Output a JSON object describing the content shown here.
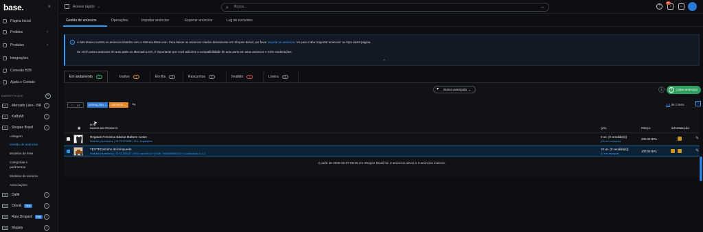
{
  "app": {
    "logo": "base."
  },
  "sidebar": {
    "collapse": "«",
    "items": [
      {
        "label": "Página Inicial"
      },
      {
        "label": "Pedidos"
      },
      {
        "label": "Produtos"
      },
      {
        "label": "Integrações"
      },
      {
        "label": "Conexão B2B"
      },
      {
        "label": "Ajuda e Contato"
      }
    ],
    "section_label": "MARKETPLACE",
    "marketplaces": [
      {
        "label": "Mercado Livre - BR",
        "icon": "ML"
      },
      {
        "label": "KaBuM!",
        "icon": "Kb"
      },
      {
        "label": "Shopee Brasil",
        "icon": "Sh"
      }
    ],
    "shopee_sub": [
      "Listagem",
      "Gestão de anúncios",
      "Modelos de frete",
      "Categorias e",
      "parâmetros",
      "Modelos de anúncio",
      "Associações"
    ],
    "more_marketplaces": [
      {
        "label": "Dafiti",
        "icon": "Da",
        "badge": ""
      },
      {
        "label": "Omnik",
        "icon": "Om",
        "badge": "Beta"
      },
      {
        "label": "Raia Drogasil",
        "icon": "RD",
        "badge": "Beta"
      },
      {
        "label": "Magalu",
        "icon": "Mg",
        "badge": ""
      }
    ]
  },
  "topbar": {
    "quick_access": "Acesso rápido",
    "search_placeholder": "Busca...",
    "notif_count": "99",
    "help": "?"
  },
  "tabs": [
    "Gestão de anúncios",
    "Operações",
    "Importar anúncios",
    "Exportar anúncios",
    "Log de excluídos"
  ],
  "info": {
    "line1_a": "A lista abaixo mostra os anúncios listados com o sistema Base.com. Para baixar os anúncios criados diretamente em Shopee Brasil, por favor ",
    "line1_link": "importe os anúncios",
    "line1_b": ". Vá para a aba 'Importar anúncios' no topo desta página.",
    "line2": "Se você possui anúncios de auto parts no Mercado Livre, é importante que você adicione a compatibilidade de auto parts em seus anúncios e evite moderações."
  },
  "status_tabs": [
    {
      "label": "Em andamento",
      "count": "2",
      "color": "green"
    },
    {
      "label": "Inativo",
      "count": "3",
      "color": "orange"
    },
    {
      "label": "Em fila",
      "count": "0",
      "color": ""
    },
    {
      "label": "Rascunhos",
      "count": "0",
      "color": ""
    },
    {
      "label": "Inválido",
      "count": "1",
      "color": "red"
    },
    {
      "label": "Lixeira",
      "count": "0",
      "color": ""
    }
  ],
  "panel": {
    "advanced_search": "Busca avançada",
    "list_button": "Listar anúncios",
    "selection": "1/2",
    "operations": "OPERAÇÕES",
    "support": "SUPORTE",
    "pagination_range": "1-2",
    "pagination_rest": " de 2 itens",
    "page": "1"
  },
  "table": {
    "headers": {
      "id": "ID ⇅",
      "product": "DADOS DO PRODUTO",
      "qty": "QTD.",
      "price": "PREÇO",
      "info": "INFORMAÇÃO"
    },
    "rows": [
      {
        "name": "Regatas Feminina Básica Malwee Coton",
        "meta": "Padrão (Inventário) | ID 72174035 | SKU regatafem",
        "qty": "0 un. (0 vendido(s))",
        "stock": "(25 em estoque)",
        "price": "200.00 BRL",
        "selected": false
      },
      {
        "name": "TESTECarrinho de brinquedo",
        "meta": "Padrão (Inventário) | ID 62435022 | SKU carrinho12 | EAN 7908508000310 | Localização A-1-1",
        "qty": "10 un. (0 vendido(s))",
        "stock": "(0 em estoque)",
        "price": "100.00 BRL",
        "selected": true
      }
    ]
  },
  "footer": "A partir de 2025-05-07 09:26 em Shopee Brasil há: 2 anúncios ativos e 3 anúncios inativos.",
  "colors": {
    "accent": "#2f9bff",
    "green": "#2e9f5e",
    "orange": "#e58a2a",
    "badge_yellow": "#c9951c"
  }
}
